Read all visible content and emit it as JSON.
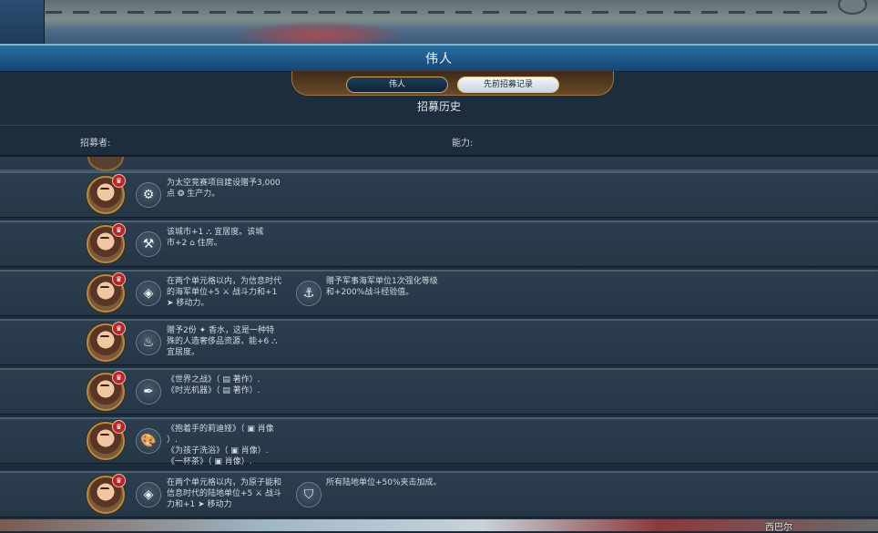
{
  "window": {
    "title": "伟人"
  },
  "tabs": [
    {
      "label": "伟人",
      "active": false
    },
    {
      "label": "先前招募记录",
      "active": true
    }
  ],
  "section_title": "招募历史",
  "columns": {
    "recruiter": "招募者:",
    "ability": "能力:"
  },
  "map": {
    "city_label": "西巴尔"
  },
  "rows": [
    {
      "badge": "♛",
      "ability1": {
        "icon": "rocket-icon",
        "glyph": "⚙",
        "text": "为太空竞赛项目建设赠予3,000\n点 ❂ 生产力。"
      },
      "ability2": null
    },
    {
      "badge": "♛",
      "ability1": {
        "icon": "tools-icon",
        "glyph": "⚒",
        "text": "该城市+1 ⛬ 宜居度。该城\n市+2 ⌂ 住房。"
      },
      "ability2": null
    },
    {
      "badge": "♛",
      "ability1": {
        "icon": "naval-icon",
        "glyph": "◈",
        "text": "在两个单元格以内，为信息时代\n的海军单位+5 ⚔ 战斗力和+1\n➤ 移动力。"
      },
      "ability2": {
        "icon": "anchor-icon",
        "glyph": "⚓",
        "text": "赠予军事海军单位1次强化等级\n和+200%战斗经验值。"
      }
    },
    {
      "badge": "♛",
      "ability1": {
        "icon": "perfume-icon",
        "glyph": "♨",
        "text": "赠予2份 ✦ 香水，这是一种特\n殊的人造奢侈品资源，能+6 ⛬\n宜居度。"
      },
      "ability2": null
    },
    {
      "badge": "♛",
      "ability1": {
        "icon": "quill-icon",
        "glyph": "✒",
        "text": "《世界之战》（ ▤ 著作）.\n《时光机器》（ ▤ 著作）."
      },
      "ability2": null
    },
    {
      "badge": "♛",
      "ability1": {
        "icon": "palette-icon",
        "glyph": "🎨",
        "text": "《抱着手的莉迪娅》（ ▣ 肖像\n）.\n《为孩子洗浴》（ ▣ 肖像）.\n《一杯茶》（ ▣ 肖像）."
      },
      "ability2": null
    },
    {
      "badge": "♛",
      "ability1": {
        "icon": "atom-icon",
        "glyph": "◈",
        "text": "在两个单元格以内，为原子能和\n信息时代的陆地单位+5 ⚔ 战斗\n力和+1 ➤ 移动力"
      },
      "ability2": {
        "icon": "rank-icon",
        "glyph": "⛉",
        "text": "所有陆地单位+50%夹击加成。"
      }
    }
  ]
}
